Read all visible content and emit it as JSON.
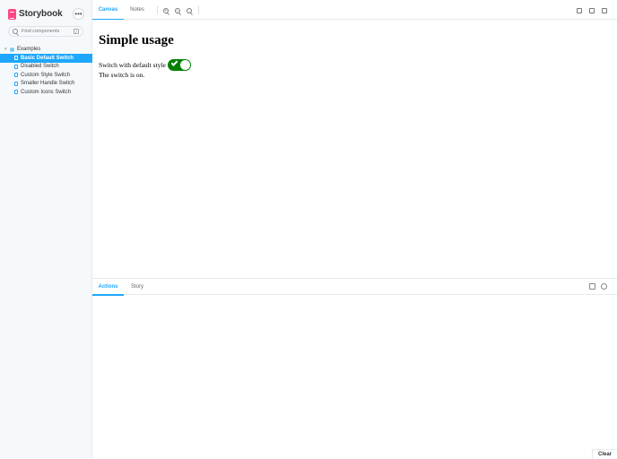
{
  "sidebar": {
    "brand": "Storybook",
    "menu_icon": "ellipsis-icon",
    "search_placeholder": "Find components",
    "search_shortcut": "/",
    "group": "Examples",
    "stories": [
      "Basic Default Switch",
      "Disabled Switch",
      "Custom Style Switch",
      "Smaller Handle Switch",
      "Custom Icons Switch"
    ],
    "active_index": 0
  },
  "toolbar": {
    "tabs": [
      "Canvas",
      "Notes"
    ],
    "active_tab": "Canvas",
    "zoom_in_symbol": "+",
    "zoom_out_symbol": "−",
    "zoom_reset_symbol": "",
    "right_icons": [
      "fullscreen-icon",
      "share-icon",
      "open-new-icon"
    ]
  },
  "canvas": {
    "title": "Simple usage",
    "label": "Switch with default style",
    "checked": true,
    "switch_on_color": "#008000",
    "status": "The switch is on."
  },
  "panel": {
    "tabs": [
      "Actions",
      "Story"
    ],
    "active_tab": "Actions",
    "clear_label": "Clear"
  },
  "colors": {
    "accent": "#1ea7fd",
    "brand": "#ff4785",
    "sidebar_bg": "#f6f9fc"
  }
}
